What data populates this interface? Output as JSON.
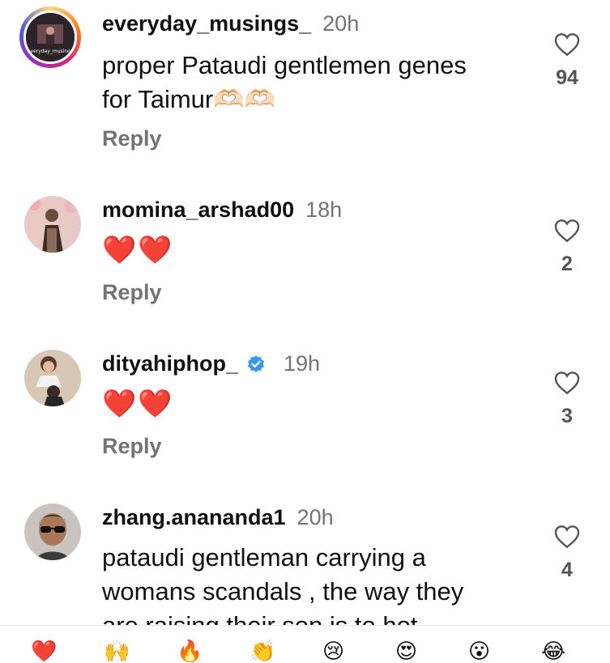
{
  "comments": [
    {
      "username": "everyday_musings_",
      "time": "20h",
      "avatar_text": "everyday_musings",
      "text_lines": [
        "proper Pataudi gentlemen genes",
        "for Taimur🫶🏻🫶🏻"
      ],
      "reply_label": "Reply",
      "likes": "94"
    },
    {
      "username": "momina_arshad00",
      "time": "18h",
      "text_lines": [
        "❤️❤️"
      ],
      "reply_label": "Reply",
      "likes": "2"
    },
    {
      "username": "dityahiphop_",
      "time": "19h",
      "verified": true,
      "text_lines": [
        "❤️❤️"
      ],
      "reply_label": "Reply",
      "likes": "3"
    },
    {
      "username": "zhang.anananda1",
      "time": "20h",
      "text_lines": [
        "pataudi gentleman carrying a",
        "womans scandals , the way they",
        "are raising their son is to hot"
      ],
      "reply_label": "",
      "likes": "4"
    }
  ],
  "colors": {
    "muted_text": "#737373",
    "verified_blue": "#3897f0",
    "heart_red": "#e0141e"
  },
  "emoji_bar": [
    "❤️",
    "🙌",
    "🔥",
    "👏",
    "😢",
    "😍",
    "😮",
    "😂"
  ]
}
